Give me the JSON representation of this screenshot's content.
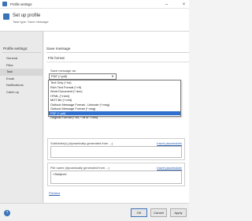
{
  "window": {
    "title": "Profile settings",
    "close_glyph": "×",
    "minimize_glyph": "–"
  },
  "header": {
    "title": "Set up profile",
    "subtitle": "Task type: Save message"
  },
  "sidebar": {
    "heading": "Profile settings:",
    "items": [
      {
        "label": "General",
        "active": false
      },
      {
        "label": "Filter",
        "active": false
      },
      {
        "label": "Task",
        "active": true
      },
      {
        "label": "Email",
        "active": false
      },
      {
        "label": "Notifications",
        "active": false
      },
      {
        "label": "Catch up",
        "active": false
      }
    ]
  },
  "main": {
    "section_title": "Save message",
    "group_title": "File format",
    "save_as_label": "Save message as:",
    "selected_format": "PDF (*.pdf)",
    "format_options": [
      "Text Only (*.txt)",
      "Rich Text Format (*.rtf)",
      "Word Document (*.doc)",
      "HTML (*.html)",
      "MHT file (*.mht)",
      "Outlook Message Format - Unicode (*.msg)",
      "Outlook Message Format (*.msg)",
      "PDF (*.pdf)",
      "Original Format (*.txt, *.rtf or *.htm)"
    ],
    "selected_index": 7,
    "subfolder_label": "Subfolder(s) (dynamically generated from ...)",
    "insert_placeholder": "Insert placeholder",
    "filename_label": "File name (dynamically generated from ...)",
    "filename_value": "<Subject>",
    "preview_link": "Preview"
  },
  "footer": {
    "ok": "OK",
    "cancel": "Cancel",
    "apply": "Apply",
    "help_glyph": "?"
  },
  "colors": {
    "accent": "#3a74b8",
    "selection": "#2f6fd0",
    "link": "#2a5db0"
  }
}
